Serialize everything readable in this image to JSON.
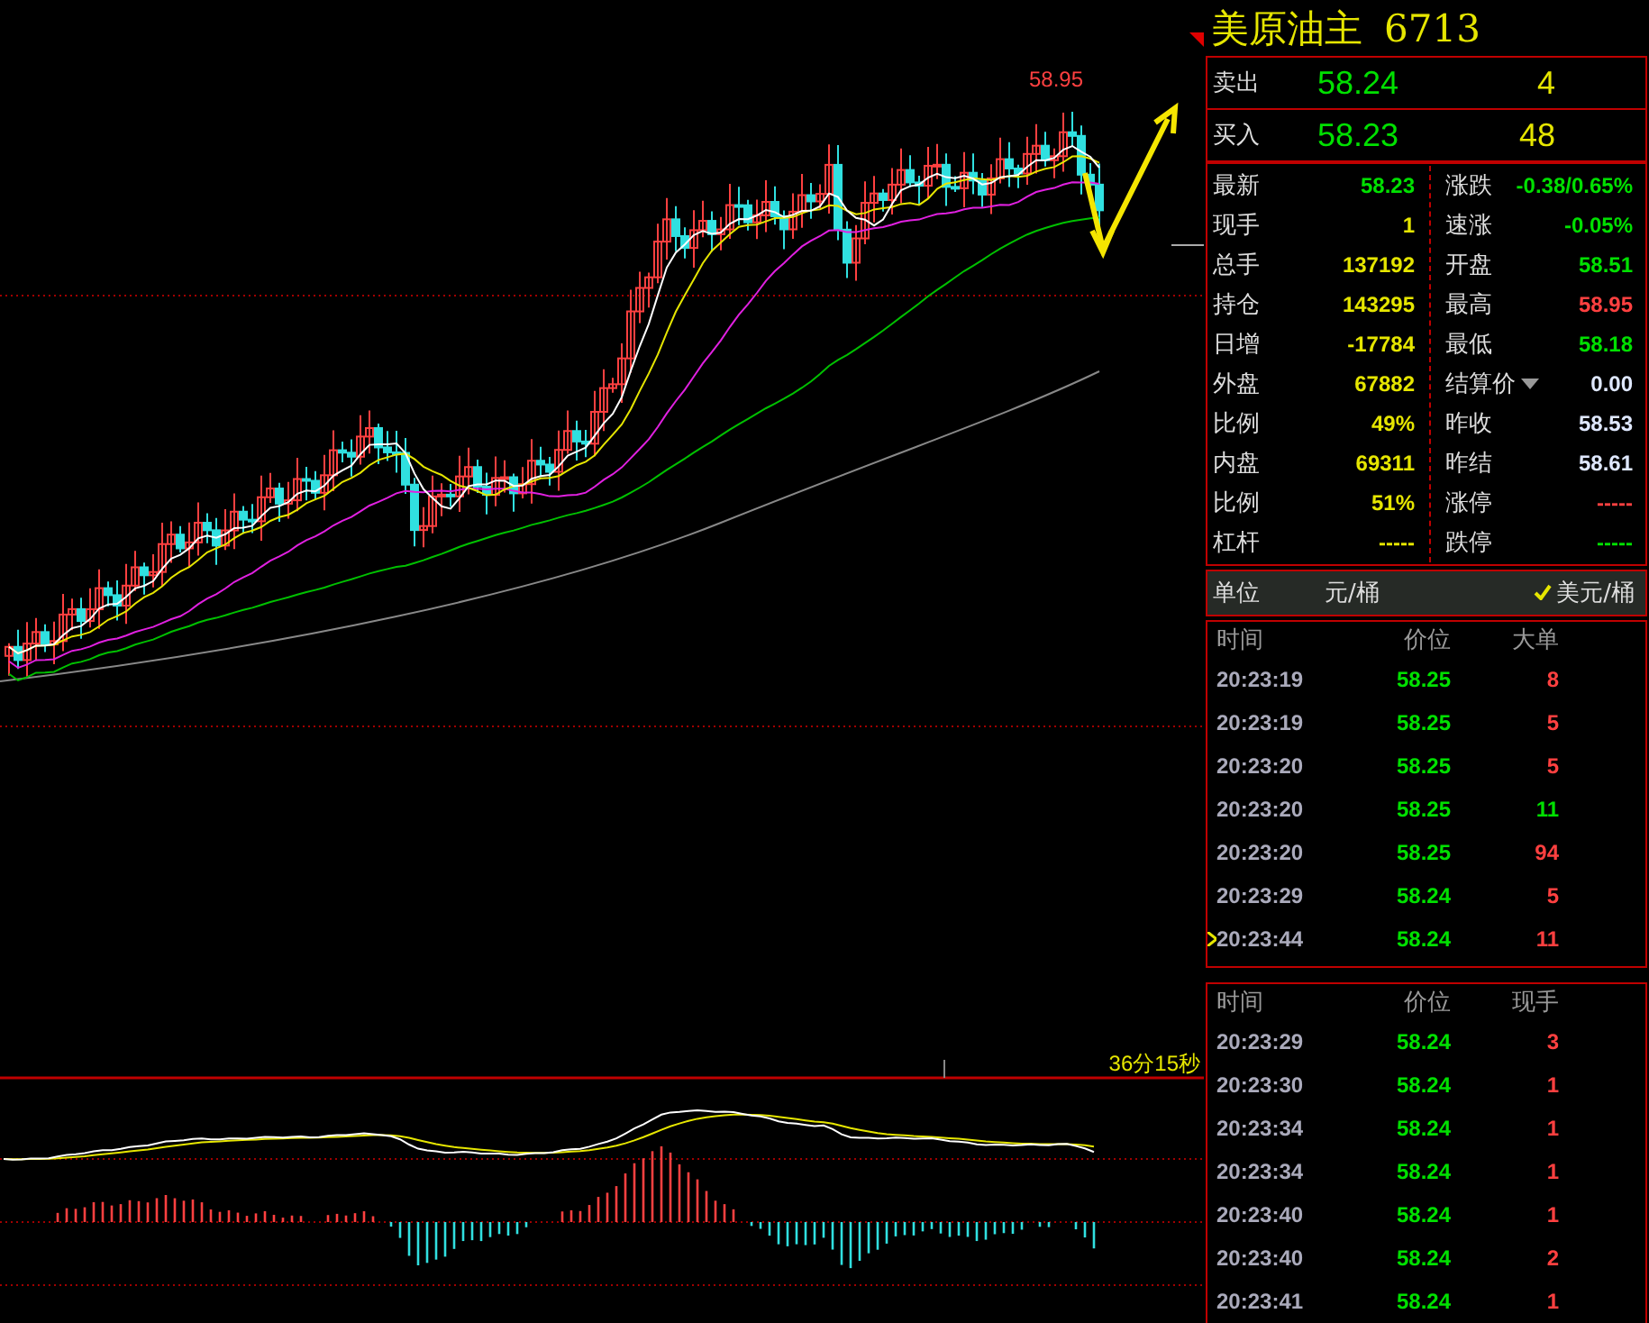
{
  "quote": {
    "name": "美原油主",
    "code": "6713"
  },
  "book": [
    {
      "label": "卖出",
      "price": "58.24",
      "volume": "4"
    },
    {
      "label": "买入",
      "price": "58.23",
      "volume": "48"
    }
  ],
  "stats_left": [
    {
      "label": "最新",
      "value": "58.23",
      "color": "#00e000"
    },
    {
      "label": "现手",
      "value": "1",
      "color": "#e6e600"
    },
    {
      "label": "总手",
      "value": "137192",
      "color": "#e6e600"
    },
    {
      "label": "持仓",
      "value": "143295",
      "color": "#e6e600"
    },
    {
      "label": "日增",
      "value": "-17784",
      "color": "#e6e600"
    },
    {
      "label": "外盘",
      "value": "67882",
      "color": "#e6e600"
    },
    {
      "label": "比例",
      "value": "49%",
      "color": "#e6e600"
    },
    {
      "label": "内盘",
      "value": "69311",
      "color": "#e6e600"
    },
    {
      "label": "比例",
      "value": "51%",
      "color": "#e6e600"
    },
    {
      "label": "杠杆",
      "value": "-----",
      "color": "#e6e600"
    }
  ],
  "stats_right": [
    {
      "label": "涨跌",
      "value": "-0.38/0.65%",
      "color": "#00e000",
      "kind": "plain"
    },
    {
      "label": "速涨",
      "value": "-0.05%",
      "color": "#00e000",
      "kind": "plain"
    },
    {
      "label": "开盘",
      "value": "58.51",
      "color": "#00e000",
      "kind": "plain"
    },
    {
      "label": "最高",
      "value": "58.95",
      "color": "#ff4040",
      "kind": "plain"
    },
    {
      "label": "最低",
      "value": "58.18",
      "color": "#00e000",
      "kind": "plain"
    },
    {
      "label": "结算价",
      "value": "0.00",
      "color": "#dfe8ff",
      "kind": "dropdown"
    },
    {
      "label": "昨收",
      "value": "58.53",
      "color": "#dfe8ff",
      "kind": "plain"
    },
    {
      "label": "昨结",
      "value": "58.61",
      "color": "#dfe8ff",
      "kind": "plain"
    },
    {
      "label": "涨停",
      "value": "-----",
      "color": "#ff4040",
      "kind": "plain"
    },
    {
      "label": "跌停",
      "value": "-----",
      "color": "#00e000",
      "kind": "plain"
    }
  ],
  "unit": {
    "label": "单位",
    "options": [
      {
        "label": "元/桶",
        "checked": false
      },
      {
        "label": "美元/桶",
        "checked": true
      }
    ]
  },
  "big_orders": {
    "columns": [
      "时间",
      "价位",
      "大单"
    ],
    "rows": [
      {
        "time": "20:23:19",
        "price": "58.25",
        "volume": "8",
        "color": "#ff4040",
        "selected": false
      },
      {
        "time": "20:23:19",
        "price": "58.25",
        "volume": "5",
        "color": "#ff4040",
        "selected": false
      },
      {
        "time": "20:23:20",
        "price": "58.25",
        "volume": "5",
        "color": "#ff4040",
        "selected": false
      },
      {
        "time": "20:23:20",
        "price": "58.25",
        "volume": "11",
        "color": "#00e000",
        "selected": false
      },
      {
        "time": "20:23:20",
        "price": "58.25",
        "volume": "94",
        "color": "#ff4040",
        "selected": false
      },
      {
        "time": "20:23:29",
        "price": "58.24",
        "volume": "5",
        "color": "#ff4040",
        "selected": false
      },
      {
        "time": "20:23:44",
        "price": "58.24",
        "volume": "11",
        "color": "#ff4040",
        "selected": true
      }
    ]
  },
  "ticks": {
    "columns": [
      "时间",
      "价位",
      "现手"
    ],
    "rows": [
      {
        "time": "20:23:29",
        "price": "58.24",
        "volume": "3",
        "color": "#ff4040"
      },
      {
        "time": "20:23:30",
        "price": "58.24",
        "volume": "1",
        "color": "#ff4040"
      },
      {
        "time": "20:23:34",
        "price": "58.24",
        "volume": "1",
        "color": "#ff4040"
      },
      {
        "time": "20:23:34",
        "price": "58.24",
        "volume": "1",
        "color": "#ff4040"
      },
      {
        "time": "20:23:40",
        "price": "58.24",
        "volume": "1",
        "color": "#ff4040"
      },
      {
        "time": "20:23:40",
        "price": "58.24",
        "volume": "2",
        "color": "#ff4040"
      },
      {
        "time": "20:23:41",
        "price": "58.24",
        "volume": "1",
        "color": "#ff4040"
      }
    ]
  },
  "chart": {
    "high_label": "58.95",
    "timer": "36分15秒"
  }
}
